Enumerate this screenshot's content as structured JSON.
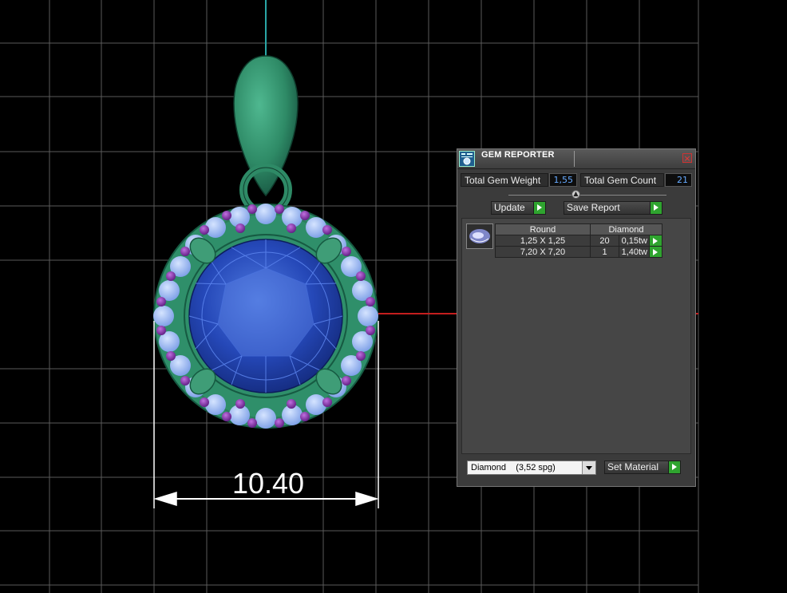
{
  "viewport": {
    "dimension_label": "10.40"
  },
  "panel": {
    "title": "GEM REPORTER",
    "total_weight_label": "Total Gem Weight",
    "total_weight_value": "1,55",
    "total_count_label": "Total Gem Count",
    "total_count_value": "21",
    "update_label": "Update",
    "save_report_label": "Save Report",
    "table": {
      "headers": [
        "Round",
        "Diamond"
      ],
      "rows": [
        {
          "size": "1,25 X 1,25",
          "count": "20",
          "weight": "0,15tw"
        },
        {
          "size": "7,20 X 7,20",
          "count": "1",
          "weight": "1,40tw"
        }
      ]
    },
    "material_select": "Diamond    (3,52 spg)",
    "set_material_label": "Set Material"
  },
  "colors": {
    "metal": "#2f8f6a",
    "center_stone": "#2548b8",
    "side_stones": "#8fb4f5",
    "prongs": "#7d2aa3",
    "accent_green": "#2fa42f"
  }
}
